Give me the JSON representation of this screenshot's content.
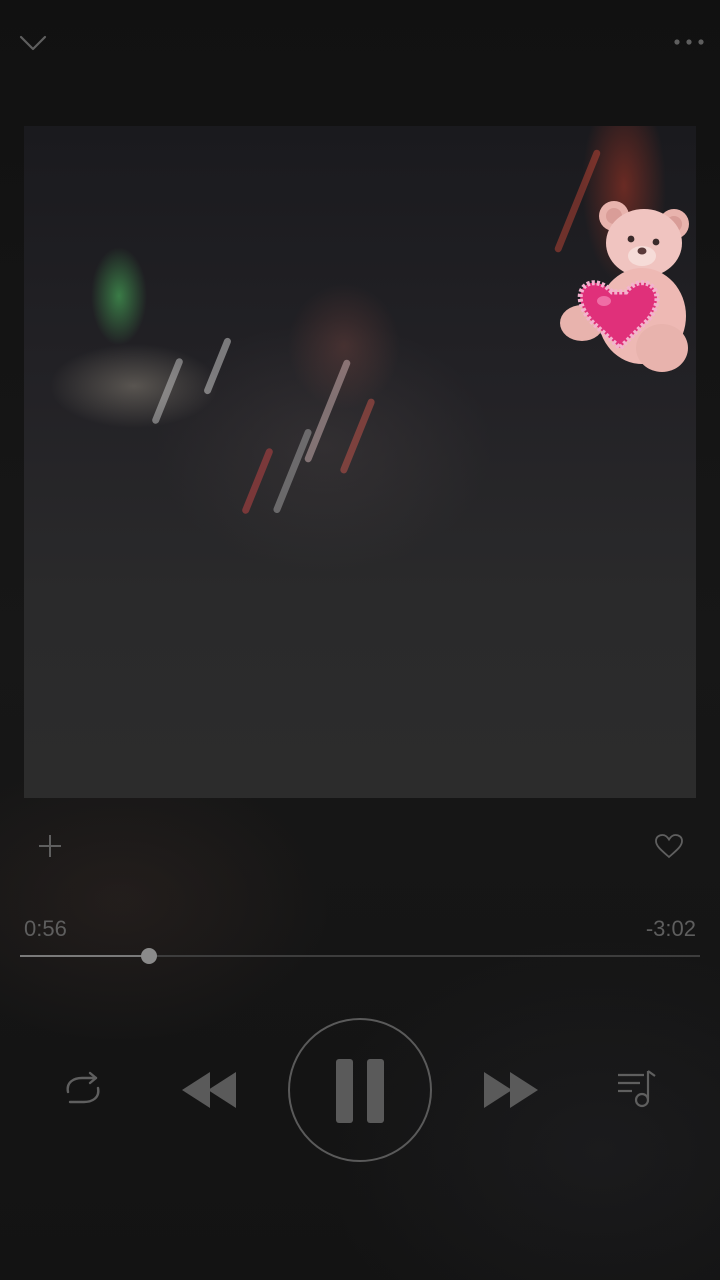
{
  "player": {
    "elapsed": "0:56",
    "remaining": "-3:02",
    "progress": 0.19
  },
  "icons": {
    "collapse": "chevron-down-icon",
    "more": "more-dots-icon",
    "add": "plus-icon",
    "like": "heart-icon",
    "repeat": "repeat-icon",
    "previous": "rewind-icon",
    "pause": "pause-icon",
    "next": "fast-forward-icon",
    "queue": "playlist-icon"
  },
  "colors": {
    "background": "#141414",
    "icon": "#6b6b6b",
    "sticker_heart": "#e0307a",
    "sticker_bear": "#f0c4c0"
  }
}
